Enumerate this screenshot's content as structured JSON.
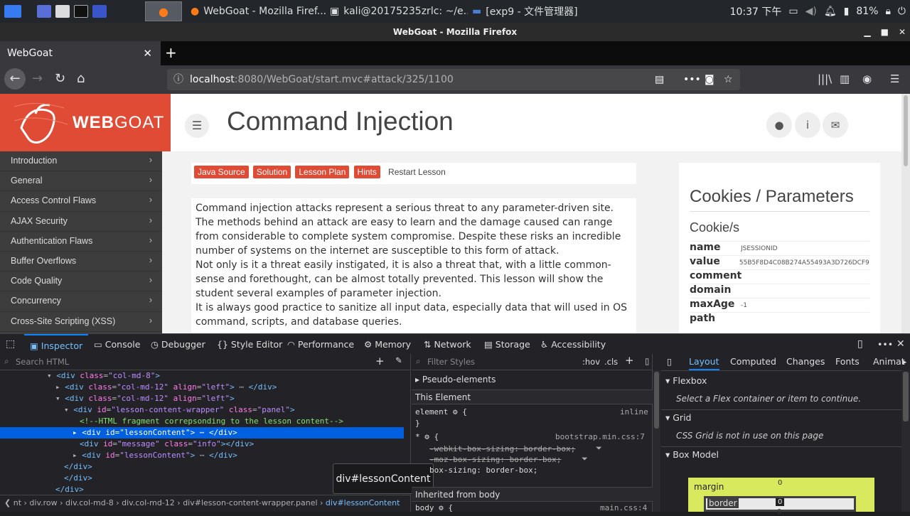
{
  "taskbar": {
    "tasks": [
      {
        "label": "WebGoat - Mozilla Firef..."
      },
      {
        "label": "kali@20175235zrlc: ~/e..."
      },
      {
        "label": "[exp9 - 文件管理器]"
      }
    ],
    "clock": "10:37 下午",
    "battery": "81%"
  },
  "window": {
    "title": "WebGoat - Mozilla Firefox"
  },
  "browser": {
    "tab_title": "WebGoat",
    "url_host": "localhost",
    "url_path": ":8080/WebGoat/start.mvc#attack/325/1100"
  },
  "webgoat": {
    "logo_text_1": "WEB",
    "logo_text_2": "GOAT",
    "page_title": "Command Injection",
    "sidebar": [
      "Introduction",
      "General",
      "Access Control Flaws",
      "AJAX Security",
      "Authentication Flaws",
      "Buffer Overflows",
      "Code Quality",
      "Concurrency",
      "Cross-Site Scripting (XSS)"
    ],
    "lesson_buttons": [
      "Java Source",
      "Solution",
      "Lesson Plan",
      "Hints"
    ],
    "restart_label": "Restart Lesson",
    "content": [
      "Command  injection attacks represent a serious threat to any parameter-driven site. The methods behind an attack are easy to learn and the damage caused can range from considerable to complete system compromise. Despite these risks an incredible number of systems on the internet are susceptible to this form of attack.",
      "Not only is it a threat easily instigated, it is also a threat that, with a little common-sense and forethought, can be almost totally prevented. This lesson will show the student several examples of parameter injection.",
      "It is always good practice to sanitize all input data, especially data that will used in OS command, scripts, and database queries."
    ],
    "cookies_title": "Cookies / Parameters",
    "cookie_subtitle": "Cookie/s",
    "cookie_rows": [
      {
        "k": "name",
        "v": "JSESSIONID"
      },
      {
        "k": "value",
        "v": "55B5F8D4C08B274A55493A3D726DCF90"
      },
      {
        "k": "comment",
        "v": ""
      },
      {
        "k": "domain",
        "v": ""
      },
      {
        "k": "maxAge",
        "v": "-1"
      },
      {
        "k": "path",
        "v": ""
      }
    ]
  },
  "devtools": {
    "tabs": [
      "Inspector",
      "Console",
      "Debugger",
      "Style Editor",
      "Performance",
      "Memory",
      "Network",
      "Storage",
      "Accessibility"
    ],
    "search_placeholder": "Search HTML",
    "filter_placeholder": "Filter Styles",
    "hov": ":hov",
    "cls": ".cls",
    "tooltip": "div#lessonContent",
    "crumbs": [
      "nt",
      "div.row",
      "div.col-md-8",
      "div.col-md-12",
      "div#lesson-content-wrapper.panel",
      "div#lessonContent"
    ],
    "rules": {
      "pseudo": "Pseudo-elements",
      "this_element": "This Element",
      "element_rule": "element",
      "inline": "inline",
      "star_source": "bootstrap.min.css:7",
      "decl1": "-webkit-box-sizing: border-box;",
      "decl2": "-moz-box-sizing: border-box;",
      "decl3": "box-sizing: border-box;",
      "inherited": "Inherited from body",
      "body_rule": "body",
      "body_source": "main.css:4"
    },
    "layout_tabs": [
      "Layout",
      "Computed",
      "Changes",
      "Fonts",
      "Animat"
    ],
    "flexbox": "Flexbox",
    "flex_note": "Select a Flex container or item to continue.",
    "grid": "Grid",
    "grid_note": "CSS Grid is not in use on this page",
    "box_model": "Box Model",
    "margin_label": "margin",
    "border_label": "border",
    "margin_top": "0",
    "border_top": "0",
    "padding_top": "0"
  }
}
